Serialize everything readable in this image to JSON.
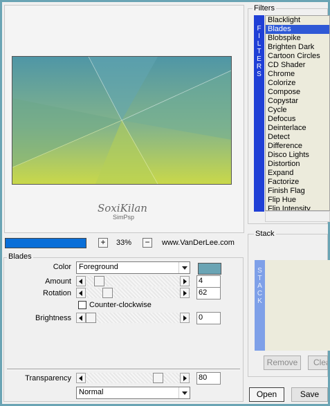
{
  "colors": {
    "window_border": "#6aa4b4",
    "zoom_bar": "#0a6fd8",
    "filters_tab": "#1f3fd6",
    "filters_selected": "#2f59d6",
    "stack_tab": "#7ea0e8",
    "list_bg": "#ecebdc",
    "color_swatch": "#6aa4b4",
    "preview_top_color": "#58a0b0",
    "preview_bottom_color": "#c4d84a"
  },
  "preview": {
    "signature": "SoxiKilan",
    "signature_sub": "SimPsp"
  },
  "zoom": {
    "plus": "+",
    "percent": "33%",
    "minus": "−",
    "brand": "www.VanDerLee.com"
  },
  "blades": {
    "title": "Blades",
    "color_label": "Color",
    "color_value": "Foreground",
    "amount_label": "Amount",
    "amount_value": "4",
    "amount_level": 0.1,
    "rotation_label": "Rotation",
    "rotation_value": "62",
    "rotation_level": 0.2,
    "ccw_label": "Counter-clockwise",
    "ccw_checked": false,
    "brightness_label": "Brightness",
    "brightness_value": "0",
    "brightness_level": 0.0,
    "transparency_label": "Transparency",
    "transparency_value": "80",
    "transparency_level": 0.8,
    "blend_value": "Normal"
  },
  "filters": {
    "title": "Filters",
    "tab_letters": [
      "F",
      "I",
      "L",
      "T",
      "E",
      "R",
      "S"
    ],
    "selected": "Blades",
    "items": [
      "Blacklight",
      "Blades",
      "Blobspike",
      "Brighten Dark",
      "Cartoon Circles",
      "CD Shader",
      "Chrome",
      "Colorize",
      "Compose",
      "Copystar",
      "Cycle",
      "Defocus",
      "Deinterlace",
      "Detect",
      "Difference",
      "Disco Lights",
      "Distortion",
      "Expand",
      "Factorize",
      "Finish Flag",
      "Flip Hue",
      "Flip Intensity"
    ]
  },
  "stack": {
    "title": "Stack",
    "tab_letters": [
      "S",
      "T",
      "A",
      "C",
      "K"
    ],
    "remove_label": "Remove",
    "clear_label": "Clear"
  },
  "buttons": {
    "open": "Open",
    "save": "Save"
  }
}
